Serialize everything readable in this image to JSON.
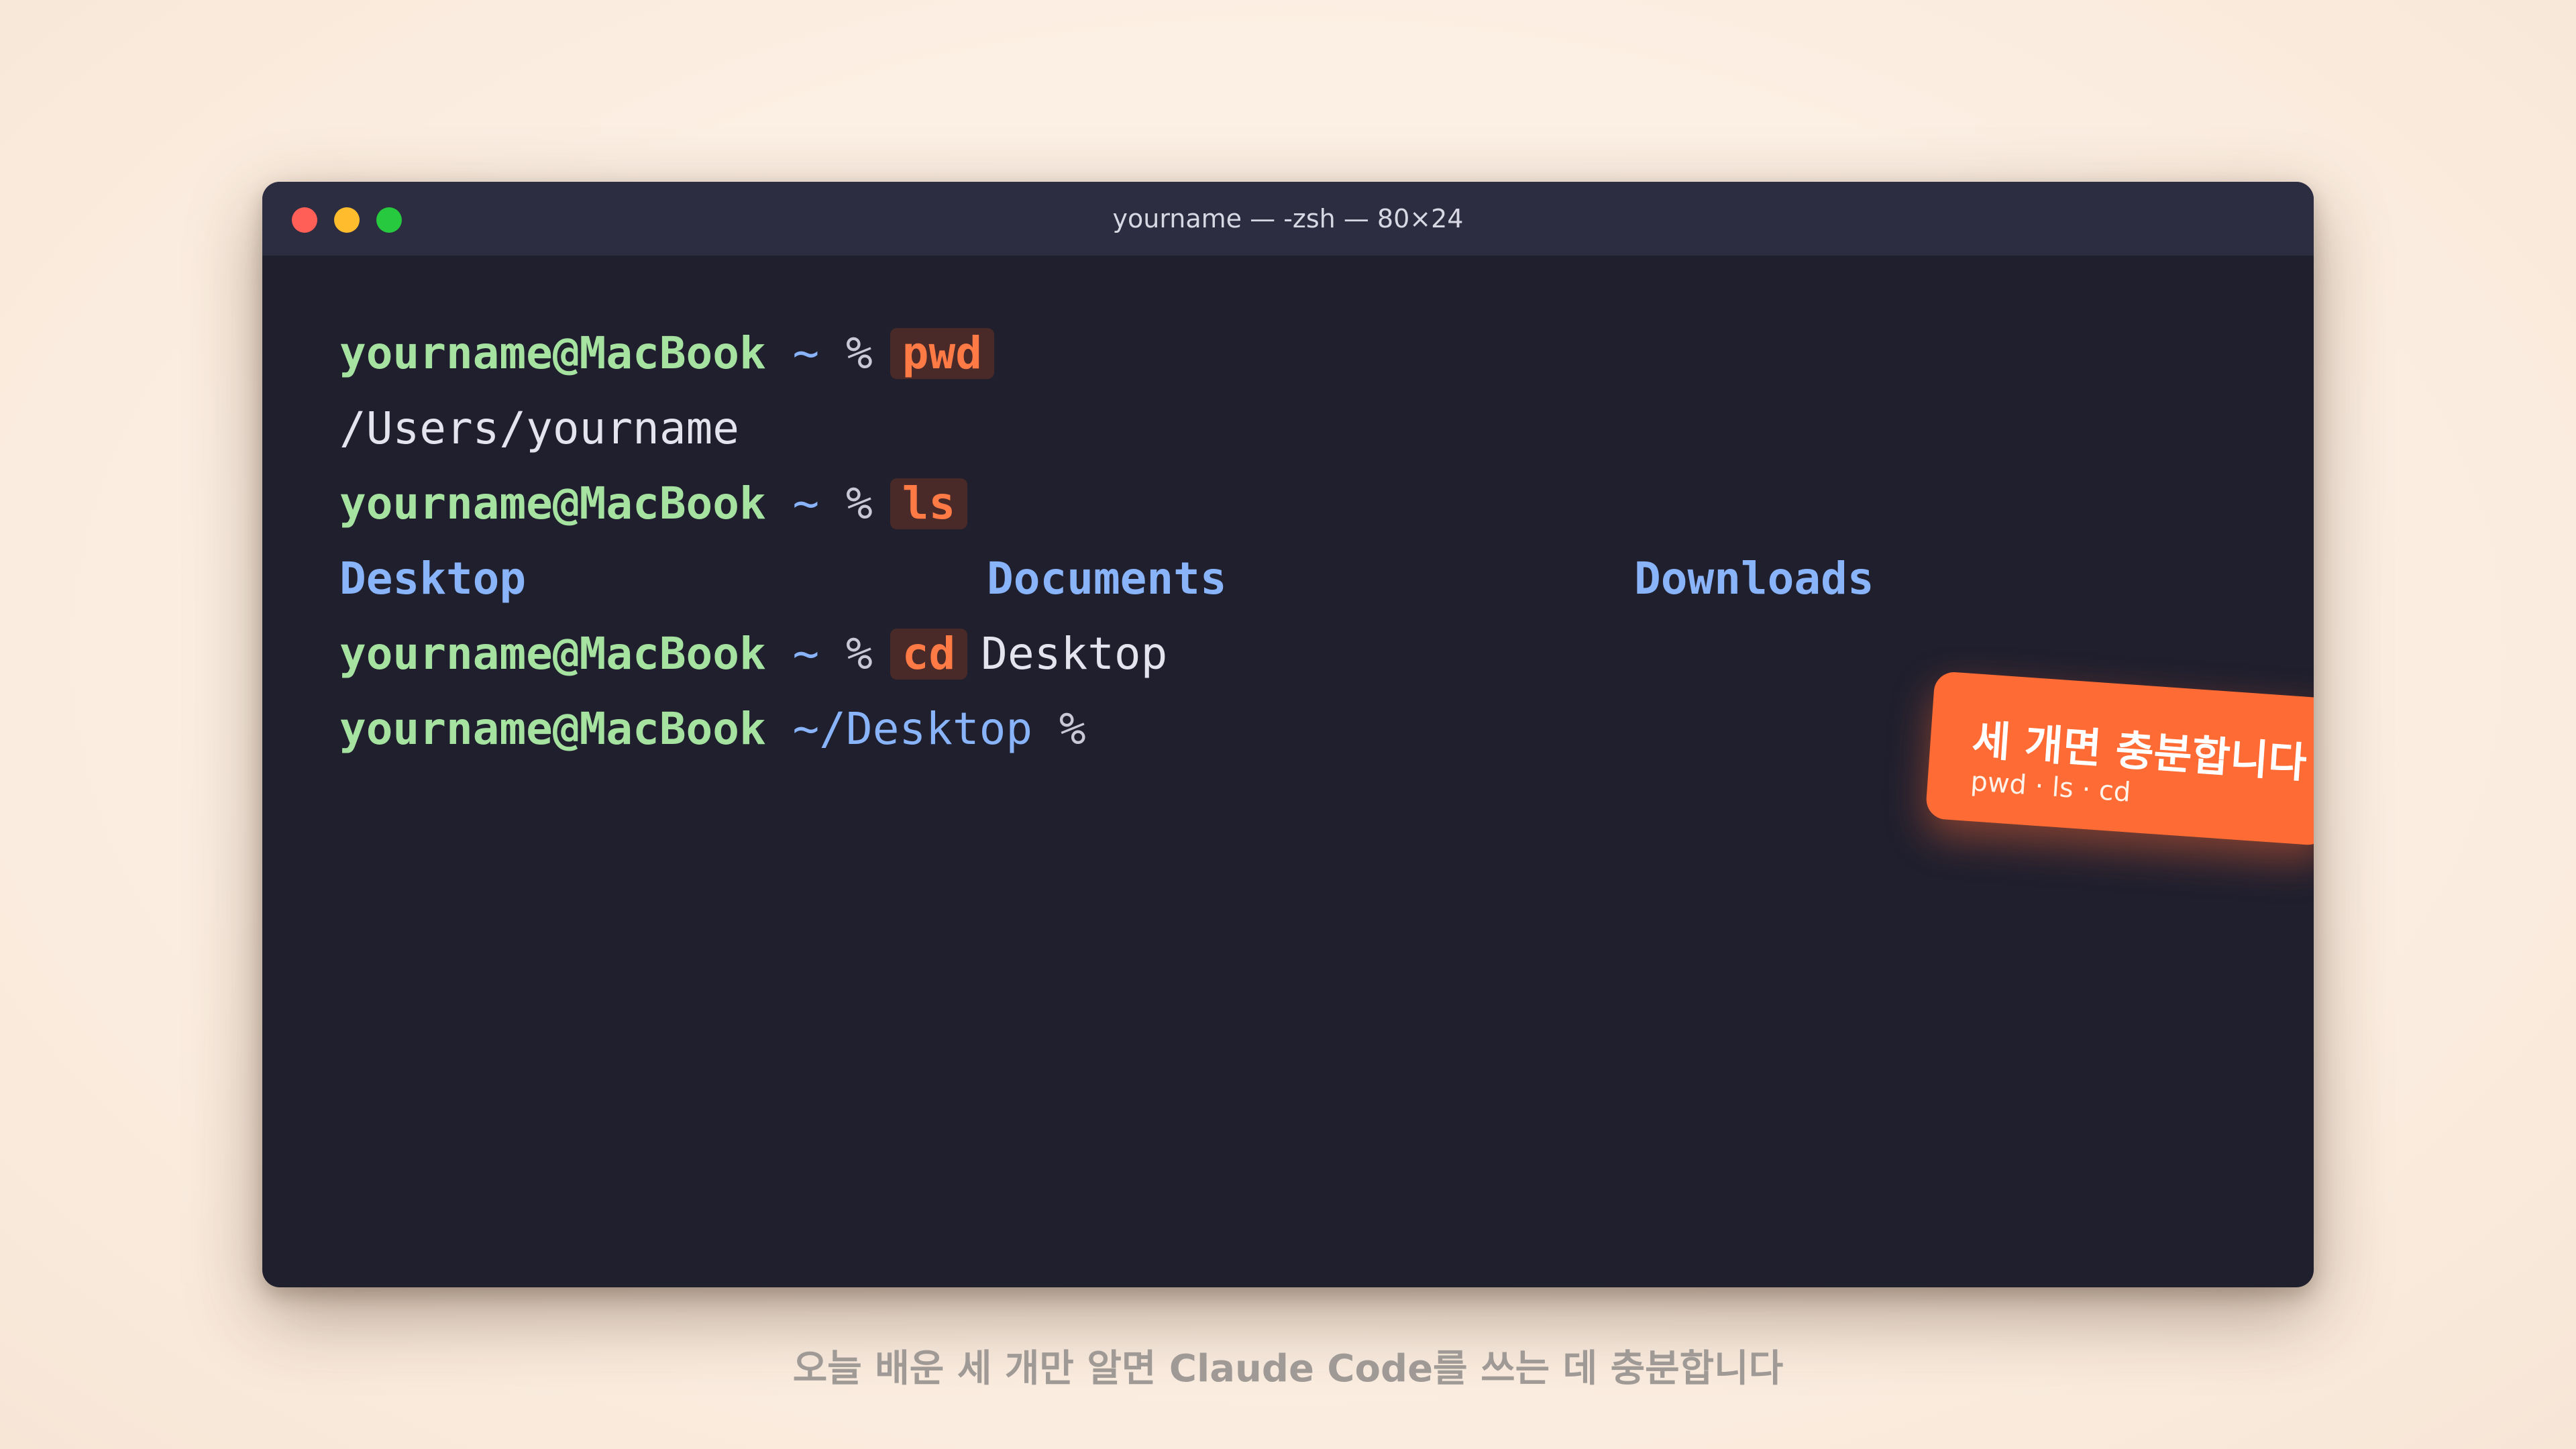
{
  "window": {
    "title": "yourname — -zsh — 80×24"
  },
  "terminal": {
    "prompt_user": "yourname@MacBook",
    "home_path": "~",
    "desktop_path": "~/Desktop",
    "prompt_symbol": "%",
    "lines": [
      {
        "type": "command",
        "command": "pwd",
        "arg": ""
      },
      {
        "type": "output",
        "text": "/Users/yourname"
      },
      {
        "type": "command",
        "command": "ls",
        "arg": ""
      },
      {
        "type": "listing",
        "entries": [
          "Desktop",
          "Documents",
          "Downloads"
        ]
      },
      {
        "type": "command",
        "command": "cd",
        "arg": "Desktop"
      },
      {
        "type": "prompt"
      }
    ]
  },
  "callout": {
    "title": "세 개면 충분합니다",
    "subtitle": "pwd · ls · cd",
    "color": "#ff6b35"
  },
  "caption": {
    "text": "오늘 배운 세 개만 알면 Claude Code를 쓰는 데 충분합니다"
  },
  "colors": {
    "terminal_bg": "#1f1f2e",
    "title_bar_bg": "#2d2d41",
    "prompt_user": "#a6e3a1",
    "path": "#89b4fa",
    "command_chip": "#ff7a45",
    "close": "#ff5f56",
    "minimize": "#ffbd2e",
    "maximize": "#27c93f"
  }
}
